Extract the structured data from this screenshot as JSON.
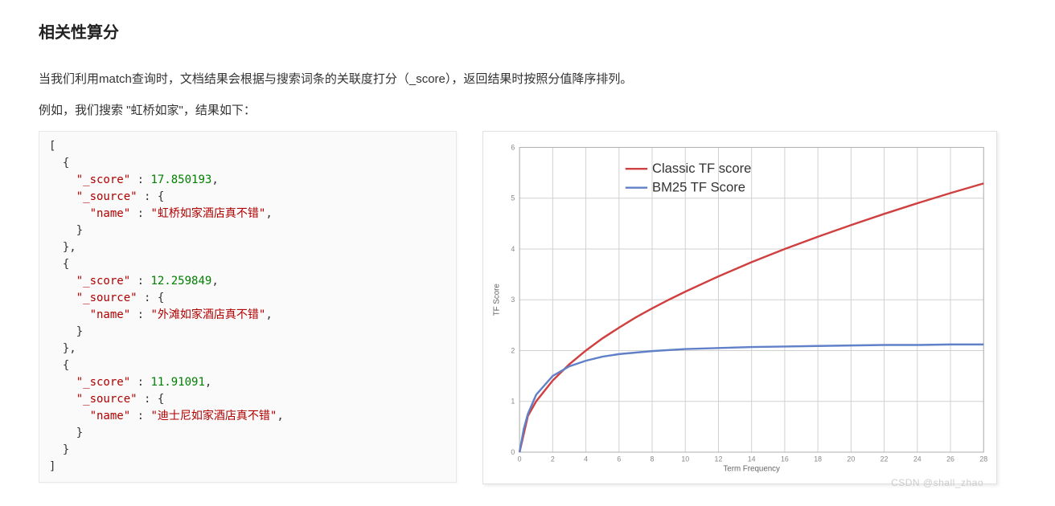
{
  "heading": "相关性算分",
  "paragraph1": "当我们利用match查询时，文档结果会根据与搜索词条的关联度打分（_score），返回结果时按照分值降序排列。",
  "paragraph2": "例如，我们搜索 \"虹桥如家\"，结果如下：",
  "code": {
    "bracket_open": "[",
    "brace_open": "{",
    "brace_close": "}",
    "bracket_close": "]",
    "comma": ",",
    "colon": " : ",
    "key_score": "\"_score\"",
    "key_source": "\"_source\"",
    "key_name": "\"name\"",
    "results": [
      {
        "score": "17.850193",
        "name": "\"虹桥如家酒店真不错\""
      },
      {
        "score": "12.259849",
        "name": "\"外滩如家酒店真不错\""
      },
      {
        "score": "11.91091",
        "name": "\"迪士尼如家酒店真不错\""
      }
    ]
  },
  "chart_data": {
    "type": "line",
    "title": "",
    "xlabel": "Term Frequency",
    "ylabel": "TF Score",
    "xlim": [
      0,
      28
    ],
    "ylim": [
      0,
      6
    ],
    "xticks": [
      0,
      2,
      4,
      6,
      8,
      10,
      12,
      14,
      16,
      18,
      20,
      22,
      24,
      26,
      28
    ],
    "yticks": [
      0,
      1,
      2,
      3,
      4,
      5,
      6
    ],
    "series": [
      {
        "name": "Classic TF score",
        "color": "#d04040",
        "x": [
          0,
          0.5,
          1,
          2,
          3,
          4,
          5,
          6,
          7,
          8,
          9,
          10,
          12,
          14,
          16,
          18,
          20,
          22,
          24,
          26,
          28
        ],
        "values": [
          0,
          0.71,
          1.0,
          1.41,
          1.73,
          2.0,
          2.24,
          2.45,
          2.65,
          2.83,
          3.0,
          3.16,
          3.46,
          3.74,
          4.0,
          4.24,
          4.47,
          4.69,
          4.9,
          5.1,
          5.29
        ]
      },
      {
        "name": "BM25 TF Score",
        "color": "#6080c8",
        "x": [
          0,
          0.25,
          0.5,
          1,
          2,
          3,
          4,
          5,
          6,
          8,
          10,
          12,
          14,
          16,
          18,
          20,
          22,
          24,
          26,
          28
        ],
        "values": [
          0,
          0.45,
          0.75,
          1.13,
          1.5,
          1.69,
          1.8,
          1.88,
          1.93,
          1.99,
          2.03,
          2.05,
          2.07,
          2.08,
          2.09,
          2.1,
          2.11,
          2.11,
          2.12,
          2.12
        ]
      }
    ],
    "legend_position": "top-right-inset"
  },
  "watermark": "CSDN @shall_zhao"
}
